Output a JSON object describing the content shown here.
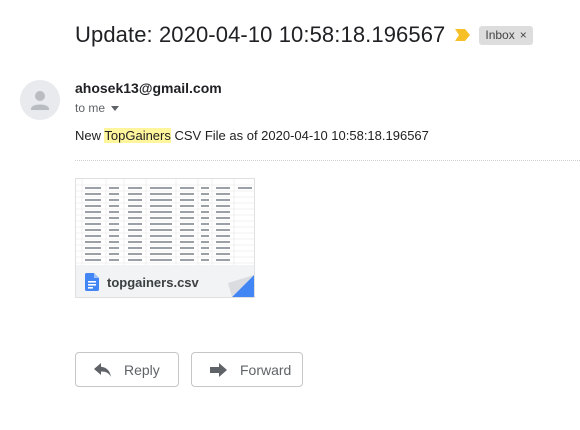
{
  "email": {
    "subject": "Update: 2020-04-10 10:58:18.196567",
    "label": "Inbox",
    "label_remove": "×",
    "sender": "ahosek13@gmail.com",
    "recipient": "to me",
    "body_prefix": "New ",
    "body_highlight": "TopGainers",
    "body_suffix": " CSV File as of 2020-04-10 10:58:18.196567"
  },
  "attachment": {
    "filename": "topgainers.csv"
  },
  "actions": {
    "reply": "Reply",
    "forward": "Forward"
  },
  "colors": {
    "importance_marker": "#f6c026",
    "highlight": "#fff59d",
    "file_icon": "#4285f4"
  },
  "icons": {
    "importance": "importance-marker-icon",
    "avatar": "person-icon",
    "file": "google-sheets-icon",
    "reply": "reply-arrow-icon",
    "forward": "forward-arrow-icon"
  }
}
